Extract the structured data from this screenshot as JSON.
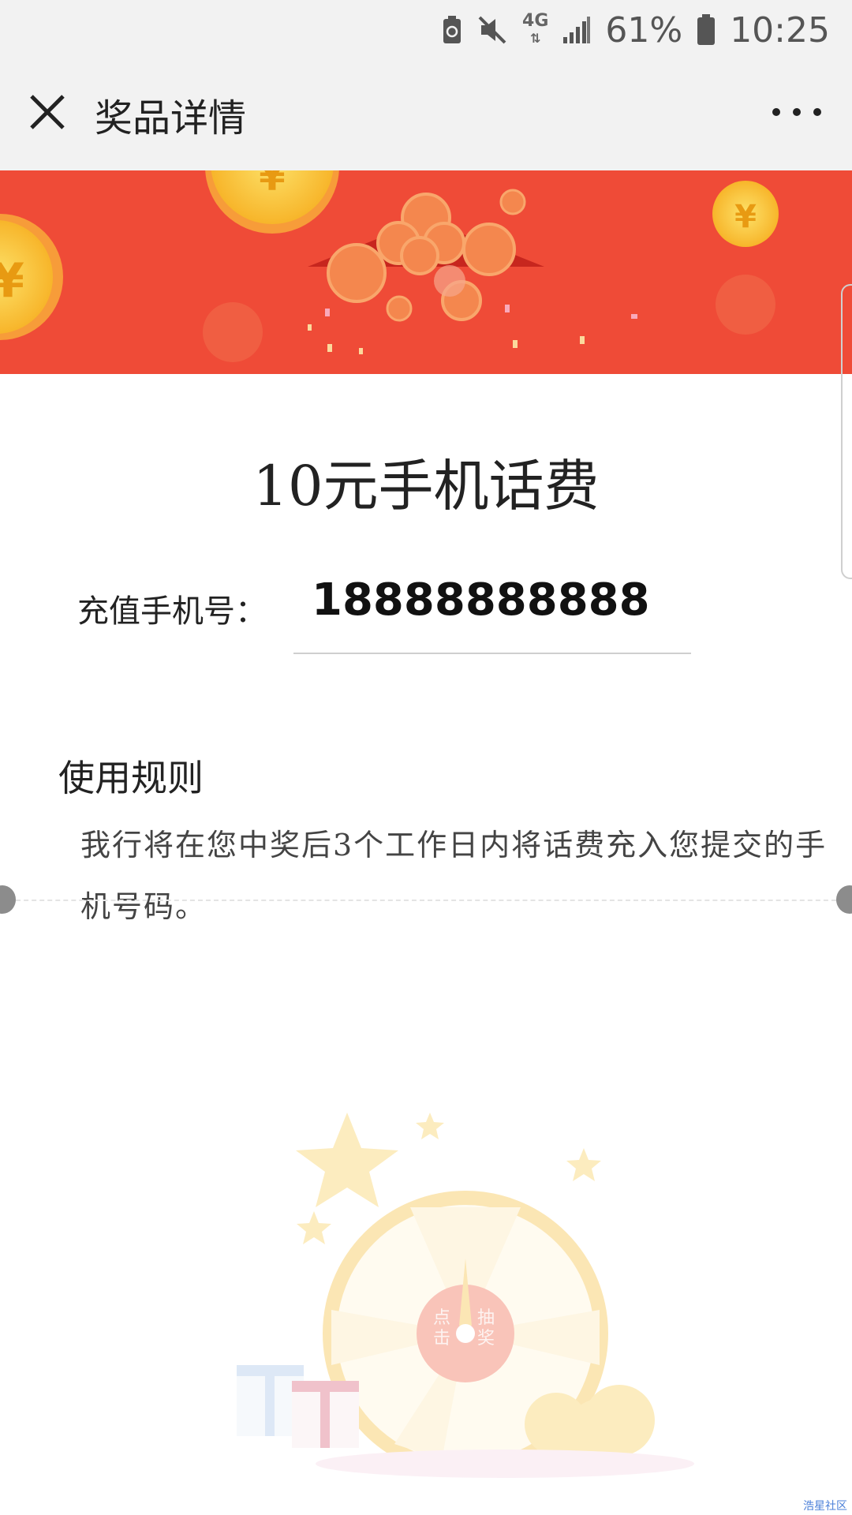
{
  "status_bar": {
    "network": "4G",
    "battery_percent": "61%",
    "time": "10:25"
  },
  "nav": {
    "title": "奖品详情"
  },
  "prize": {
    "title": "10元手机话费"
  },
  "recharge": {
    "label": "充值手机号：",
    "phone": "18888888888"
  },
  "rules": {
    "heading": "使用规则",
    "text": "我行将在您中奖后3个工作日内将话费充入您提交的手机号码。"
  },
  "wheel": {
    "left_label": "点击",
    "right_label": "抽奖"
  },
  "watermark": "浩星社区",
  "colors": {
    "banner": "#ef4b37",
    "coin": "#f7c72c",
    "nav_bg": "#f2f2f2"
  }
}
